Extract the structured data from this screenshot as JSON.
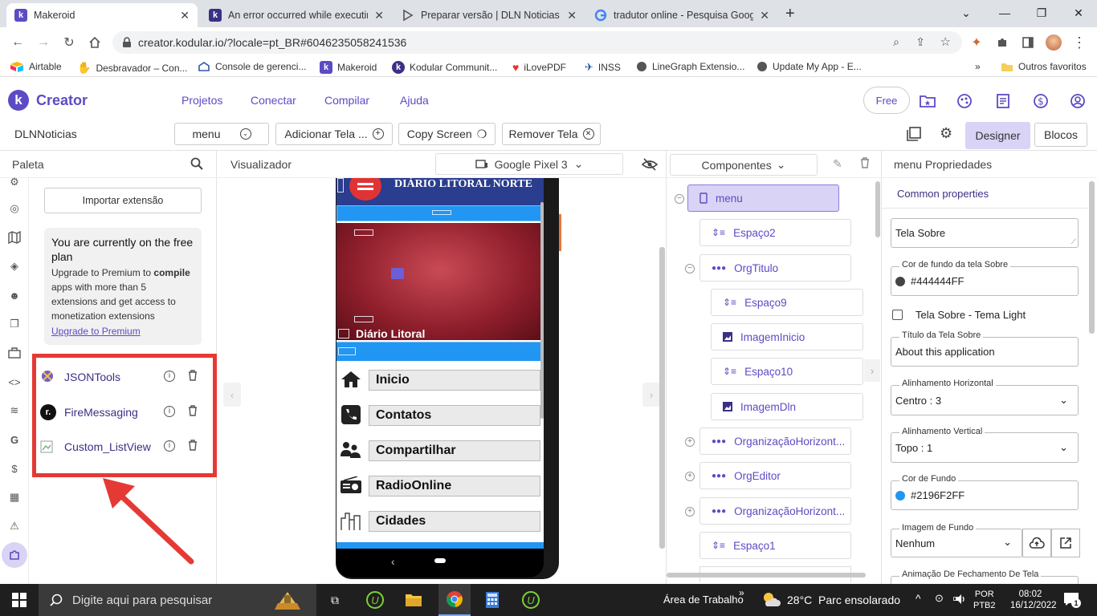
{
  "browser": {
    "tabs": [
      {
        "title": "Makeroid",
        "active": true,
        "fav_color": "#5b4bc4",
        "fav_letter": "k"
      },
      {
        "title": "An error occurred while executing",
        "active": false,
        "fav_color": "#3a3084",
        "fav_letter": "k"
      },
      {
        "title": "Preparar versão | DLN Noticias",
        "active": false,
        "fav_color": "#00897b",
        "fav_letter": "▷"
      },
      {
        "title": "tradutor online - Pesquisa Google",
        "active": false,
        "fav_color": "#4285f4",
        "fav_letter": "G"
      }
    ],
    "address": "creator.kodular.io/?locale=pt_BR#6046235058241536",
    "bookmarks": [
      {
        "label": "Airtable",
        "icon": "airtable-icon"
      },
      {
        "label": "Desbravador – Con...",
        "icon": "desbravador-icon"
      },
      {
        "label": "Console de gerenci...",
        "icon": "console-icon"
      },
      {
        "label": "Makeroid",
        "icon": "makeroid-icon"
      },
      {
        "label": "Kodular Communit...",
        "icon": "kodular-community-icon"
      },
      {
        "label": "iLovePDF",
        "icon": "ilovepdf-icon"
      },
      {
        "label": "INSS",
        "icon": "inss-icon"
      },
      {
        "label": "LineGraph Extensio...",
        "icon": "globe-icon"
      },
      {
        "label": "Update My App - E...",
        "icon": "globe-icon"
      }
    ],
    "other_bookmarks": "Outros favoritos"
  },
  "header": {
    "brand": "Creator",
    "menu": [
      "Projetos",
      "Conectar",
      "Compilar",
      "Ajuda"
    ],
    "free_badge": "Free"
  },
  "toolbar": {
    "project_name": "DLNNoticias",
    "screen_select": "menu",
    "add_screen": "Adicionar Tela ...",
    "copy_screen": "Copy Screen",
    "remove_screen": "Remover Tela",
    "designer": "Designer",
    "blocks": "Blocos"
  },
  "palette": {
    "title": "Paleta",
    "import_button": "Importar extensão",
    "free_plan_title": "You are currently on the free plan",
    "free_plan_text_1": "Upgrade to Premium to",
    "free_plan_bold": "compile",
    "free_plan_text_2": "apps with more than 5 extensions and get access to monetization extensions",
    "upgrade_link": "Upgrade to Premium",
    "extensions": [
      {
        "name": "JSONTools"
      },
      {
        "name": "FireMessaging"
      },
      {
        "name": "Custom_ListView"
      }
    ]
  },
  "viewer": {
    "title": "Visualizador",
    "device": "Google Pixel 3",
    "app_header": "DIÁRIO LITORAL NORTE",
    "image_caption": "Diário Litoral",
    "menu_buttons": [
      "Inicio",
      "Contatos",
      "Compartilhar",
      "RadioOnline",
      "Cidades"
    ]
  },
  "tree": {
    "title": "Componentes",
    "nodes": [
      {
        "label": "menu",
        "icon": "phone-icon"
      },
      {
        "label": "Espaço2",
        "icon": "spacer-icon"
      },
      {
        "label": "OrgTitulo",
        "icon": "arrangement-icon"
      },
      {
        "label": "Espaço9",
        "icon": "spacer-icon"
      },
      {
        "label": "ImagemInicio",
        "icon": "image-icon"
      },
      {
        "label": "Espaço10",
        "icon": "spacer-icon"
      },
      {
        "label": "ImagemDln",
        "icon": "image-icon"
      },
      {
        "label": "OrganizaçãoHorizont...",
        "icon": "arrangement-icon"
      },
      {
        "label": "OrgEditor",
        "icon": "arrangement-icon"
      },
      {
        "label": "OrganizaçãoHorizont...",
        "icon": "arrangement-icon"
      },
      {
        "label": "Espaço1",
        "icon": "spacer-icon"
      }
    ]
  },
  "props": {
    "title": "menu Propriedades",
    "common": "Common properties",
    "about_screen": "Tela Sobre",
    "about_bg_label": "Cor de fundo da tela Sobre",
    "about_bg_value": "#444444FF",
    "about_light_label": "Tela Sobre - Tema Light",
    "about_title_label": "Título da Tela Sobre",
    "about_title_value": "About this application",
    "align_h_label": "Alinhamento Horizontal",
    "align_h_value": "Centro : 3",
    "align_v_label": "Alinhamento Vertical",
    "align_v_value": "Topo : 1",
    "bg_label": "Cor de Fundo",
    "bg_value": "#2196F2FF",
    "bg_image_label": "Imagem de Fundo",
    "bg_image_value": "Nenhum",
    "close_anim_label": "Animação De Fechamento De Tela"
  },
  "taskbar": {
    "search_placeholder": "Digite aqui para pesquisar",
    "desktop": "Área de Trabalho",
    "weather": "28°C  Parc ensolarado",
    "lang": "POR",
    "lang2": "PTB2",
    "time": "08:02",
    "date": "16/12/2022",
    "notif_count": "1"
  },
  "colors": {
    "brand": "#5b4bc4",
    "highlight_red": "#e53935",
    "app_blue": "#2196f3",
    "selected_node": "#d9d3f5"
  }
}
